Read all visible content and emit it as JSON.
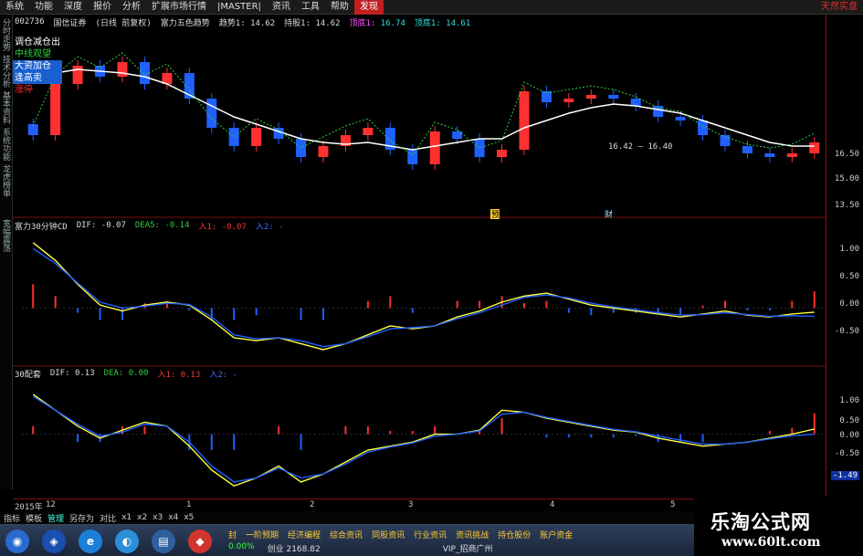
{
  "menubar": {
    "items": [
      "系统",
      "功能",
      "深度",
      "报价",
      "分析",
      "扩展市场行情",
      "|MASTER|",
      "资讯",
      "工具",
      "帮助"
    ],
    "active": "发现",
    "right": "天然实盘"
  },
  "left_tabs": [
    "分时走势",
    "技术分析",
    "基本资料",
    "系统功能",
    "龙虎榜单"
  ],
  "left_tabs_lower": [
    "宽幅震荡"
  ],
  "price_header": {
    "code": "002736",
    "name": "国信证券",
    "period": "(日线 前复权)",
    "indicator": "富力五色趋势",
    "trend_label": "趋势1:",
    "trend_value": "14.62",
    "hold_label": "持股1:",
    "hold_value": "14.62",
    "top_label": "顶底1:",
    "top_value": "16.74",
    "bottom_label": "顶底1:",
    "bottom_value": "14.61"
  },
  "legend": {
    "items": [
      {
        "text": "调仓减仓出",
        "color": "#ffffff",
        "bg": ""
      },
      {
        "text": "中线观望",
        "color": "#2ecc40",
        "bg": ""
      },
      {
        "text": "大资加仓",
        "color": "#ffffff",
        "bg": "#1a5fd0"
      },
      {
        "text": "逢高卖",
        "color": "#ffffff",
        "bg": "#1a5fd0"
      },
      {
        "text": "涨停",
        "color": "#ff3030",
        "bg": ""
      }
    ]
  },
  "price_axis": [
    "16.50",
    "15.00",
    "13.50"
  ],
  "annotations": {
    "range": "16.42 — 16.40",
    "mark1": "预",
    "mark2": "财"
  },
  "panel2_header": {
    "title": "富力30分钟CD",
    "dif_label": "DIF:",
    "dif_value": "-0.07",
    "dea_label": "DEA5:",
    "dea_value": "-0.14",
    "in1_label": "入1:",
    "in1_value": "-0.07",
    "in2_label": "入2:",
    "in2_value": "-"
  },
  "panel2_axis": [
    "1.00",
    "0.50",
    "0.00",
    "-0.50"
  ],
  "panel3_header": {
    "title": "30配套",
    "dif_label": "DIF:",
    "dif_value": "0.13",
    "dea_label": "DEA:",
    "dea_value": "0.00",
    "in1_label": "入1:",
    "in1_value": "0.13",
    "in2_label": "入2:",
    "in2_value": "-"
  },
  "panel3_axis": [
    "1.00",
    "0.50",
    "0.00",
    "-0.50"
  ],
  "panel3_current": "-1.49",
  "date_axis": {
    "year_label": "2015年",
    "month_labels": [
      "12",
      "1",
      "2",
      "3",
      "4",
      "5"
    ]
  },
  "toolbar": {
    "buttons": [
      "指标",
      "模板",
      "管理",
      "另存为",
      "对比",
      "x1",
      "x2",
      "x3",
      "x4",
      "x5"
    ],
    "active": "管理"
  },
  "taskbar": {
    "ticker": [
      "封",
      "一阶预期",
      "经济编程",
      "综合资讯",
      "同股资讯",
      "行业资讯",
      "资讯挑战",
      "持仓股份",
      "账户资金"
    ],
    "index_pct": "0.00%",
    "index_label": "创业",
    "index_value": "2168.82",
    "vip": "VIP_招商广州"
  },
  "brand": {
    "title": "乐淘公式网",
    "url": "www.60lt.com"
  },
  "colors": {
    "up": "#ff3030",
    "down": "#2060ff",
    "green": "#2ecc40",
    "yellow": "#ffff40",
    "white": "#ffffff",
    "purple": "#b040ff",
    "frame": "#7a1010"
  },
  "chart_data": [
    {
      "type": "candlestick",
      "title": "富力五色趋势",
      "ylim": [
        13.2,
        17.5
      ],
      "yticks": [
        13.5,
        15.0,
        16.5
      ],
      "x": [
        "12",
        "1",
        "2",
        "3",
        "4",
        "5"
      ],
      "close": [
        15.2,
        16.6,
        17.1,
        16.8,
        17.2,
        16.6,
        16.9,
        16.2,
        15.4,
        14.9,
        15.4,
        15.1,
        14.6,
        14.9,
        15.2,
        15.4,
        14.8,
        14.4,
        15.3,
        15.1,
        14.6,
        14.8,
        16.4,
        16.1,
        16.2,
        16.3,
        16.2,
        16.0,
        15.7,
        15.6,
        15.2,
        14.9,
        14.7,
        14.6,
        14.7,
        15.0
      ],
      "ma_trend": [
        16.8,
        16.9,
        17.0,
        16.95,
        16.9,
        16.8,
        16.6,
        16.3,
        16.0,
        15.7,
        15.5,
        15.3,
        15.1,
        15.0,
        14.95,
        15.0,
        14.9,
        14.8,
        14.9,
        15.0,
        15.1,
        15.1,
        15.4,
        15.6,
        15.8,
        15.95,
        16.05,
        16.0,
        15.9,
        15.8,
        15.6,
        15.4,
        15.2,
        15.0,
        14.9,
        14.9
      ]
    },
    {
      "type": "line",
      "title": "富力30分钟CD",
      "ylim": [
        -0.9,
        1.25
      ],
      "yticks": [
        1.0,
        0.5,
        0.0,
        -0.5
      ],
      "series": [
        {
          "name": "DIF",
          "values": [
            1.1,
            0.8,
            0.4,
            0.05,
            -0.05,
            0.05,
            0.1,
            0.05,
            -0.2,
            -0.5,
            -0.55,
            -0.5,
            -0.6,
            -0.7,
            -0.6,
            -0.45,
            -0.3,
            -0.35,
            -0.3,
            -0.15,
            -0.05,
            0.1,
            0.2,
            0.25,
            0.15,
            0.05,
            0.0,
            -0.05,
            -0.1,
            -0.15,
            -0.1,
            -0.05,
            -0.12,
            -0.15,
            -0.1,
            -0.07
          ]
        },
        {
          "name": "DEA5",
          "values": [
            1.0,
            0.75,
            0.42,
            0.1,
            0.0,
            0.03,
            0.08,
            0.06,
            -0.15,
            -0.45,
            -0.52,
            -0.5,
            -0.55,
            -0.65,
            -0.6,
            -0.48,
            -0.35,
            -0.33,
            -0.3,
            -0.18,
            -0.08,
            0.05,
            0.18,
            0.22,
            0.17,
            0.08,
            0.02,
            -0.03,
            -0.08,
            -0.12,
            -0.11,
            -0.08,
            -0.11,
            -0.14,
            -0.13,
            -0.14
          ]
        }
      ]
    },
    {
      "type": "line",
      "title": "30配套",
      "ylim": [
        -1.5,
        1.25
      ],
      "yticks": [
        1.0,
        0.5,
        0.0,
        -0.5
      ],
      "series": [
        {
          "name": "DIF",
          "values": [
            1.0,
            0.6,
            0.2,
            -0.1,
            0.1,
            0.3,
            0.2,
            -0.3,
            -0.9,
            -1.3,
            -1.1,
            -0.8,
            -1.2,
            -1.0,
            -0.7,
            -0.4,
            -0.3,
            -0.2,
            0.0,
            0.0,
            0.1,
            0.6,
            0.55,
            0.4,
            0.3,
            0.2,
            0.1,
            0.05,
            -0.1,
            -0.2,
            -0.3,
            -0.25,
            -0.2,
            -0.1,
            0.0,
            0.13
          ]
        },
        {
          "name": "DEA",
          "values": [
            0.95,
            0.6,
            0.25,
            -0.05,
            0.05,
            0.25,
            0.2,
            -0.2,
            -0.8,
            -1.2,
            -1.1,
            -0.85,
            -1.1,
            -1.0,
            -0.75,
            -0.45,
            -0.32,
            -0.22,
            -0.05,
            0.0,
            0.08,
            0.5,
            0.55,
            0.42,
            0.32,
            0.22,
            0.12,
            0.06,
            -0.05,
            -0.15,
            -0.25,
            -0.25,
            -0.2,
            -0.12,
            -0.04,
            0.0
          ]
        }
      ]
    }
  ]
}
